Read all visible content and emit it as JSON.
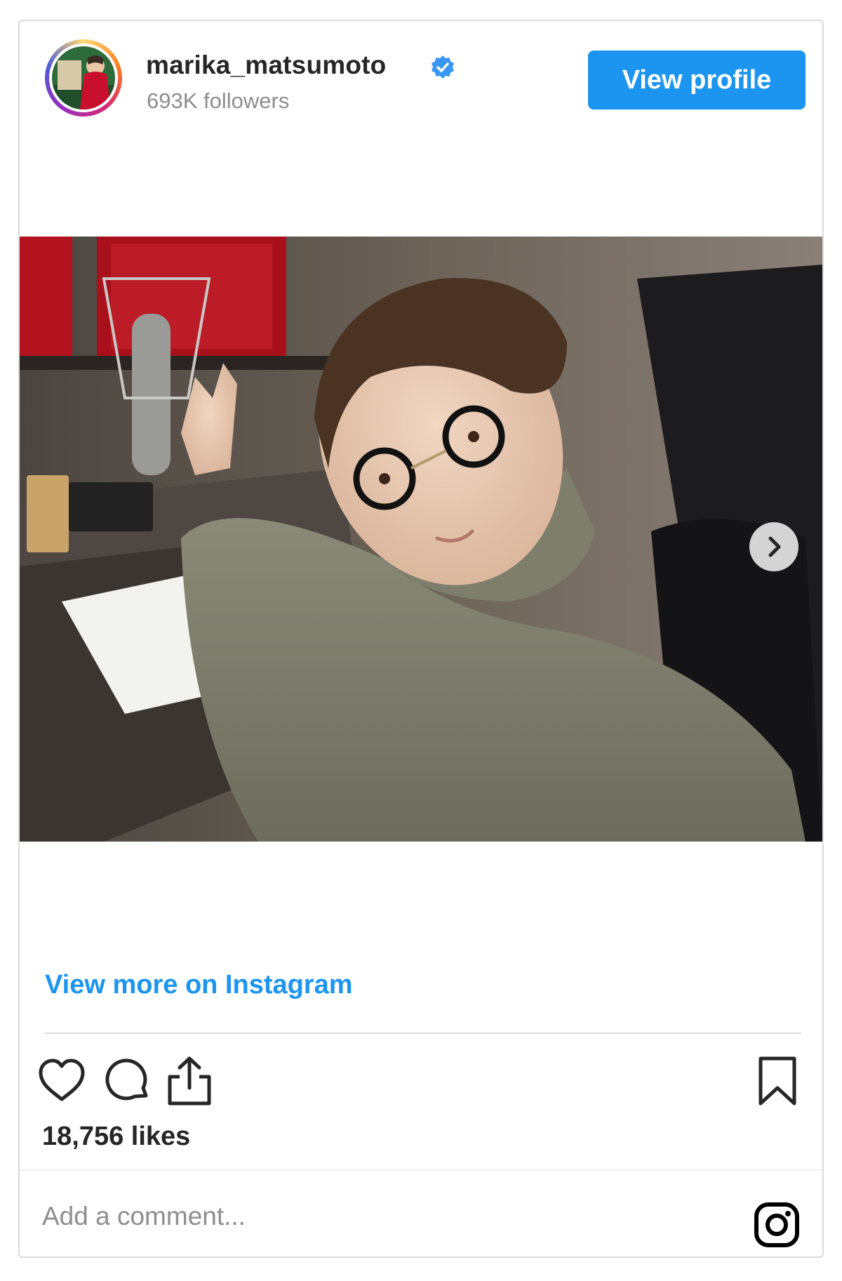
{
  "post": {
    "username": "marika_matsumoto",
    "followers": "693K followers",
    "view_profile_label": "View profile",
    "view_more_label": "View more on Instagram",
    "likes": "18,756 likes",
    "comment_placeholder": "Add a comment...",
    "verified": true
  },
  "icons": {
    "verified": "verified-badge-icon",
    "next": "chevron-right-icon",
    "like": "heart-icon",
    "comment": "comment-bubble-icon",
    "share": "share-icon",
    "save": "bookmark-icon",
    "instagram": "instagram-logo-icon"
  },
  "colors": {
    "accent": "#1b95f0",
    "border": "#dbdbdb",
    "muted": "#8e8e8e",
    "text": "#262626"
  }
}
